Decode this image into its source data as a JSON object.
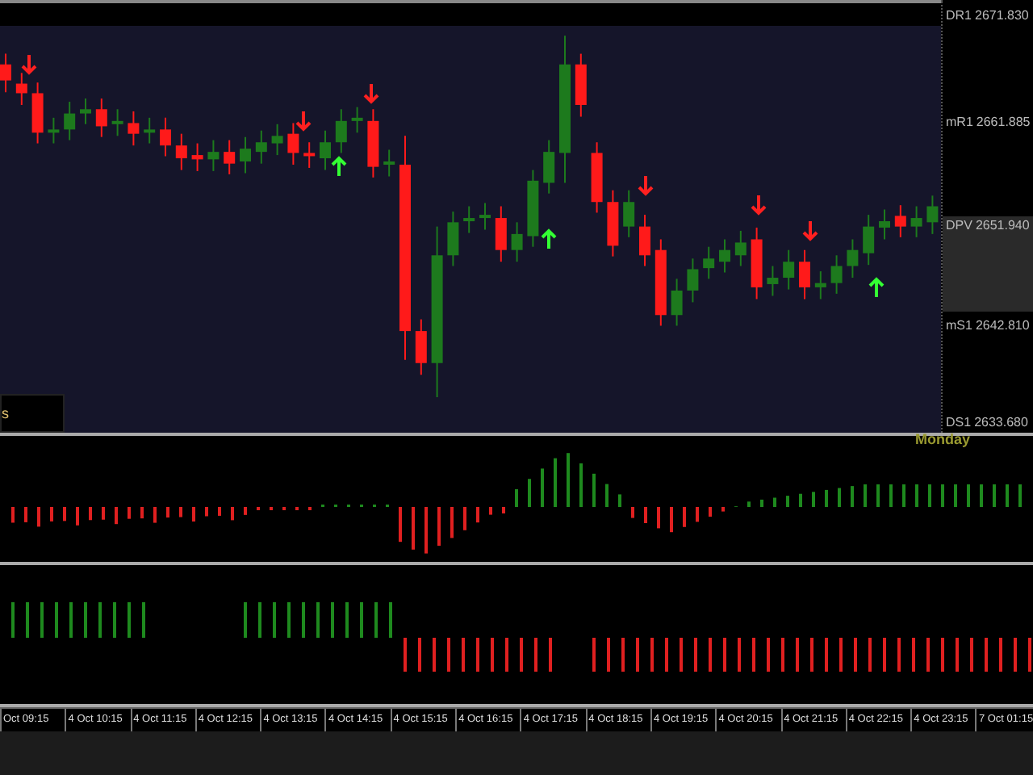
{
  "price_axis": [
    {
      "label": "DR1",
      "kind": "level"
    },
    {
      "label": "mR1",
      "kind": "level"
    },
    {
      "label": "DPV",
      "kind": "pivot"
    },
    {
      "label": "mS1",
      "kind": "level"
    },
    {
      "label": "DS1",
      "kind": "level"
    }
  ],
  "chart_data": {
    "type": "candlestick",
    "ylim": [
      2632.77,
      2673.34
    ],
    "yticks": [
      {
        "value": 2671.83,
        "label": "2671.830"
      },
      {
        "value": 2661.885,
        "label": "2661.885"
      },
      {
        "value": 2651.94,
        "label": "2651.940"
      },
      {
        "value": 2642.81,
        "label": "2642.810"
      },
      {
        "value": 2633.68,
        "label": "2633.680"
      }
    ],
    "categories": [
      null,
      null,
      null,
      null,
      null,
      null,
      null,
      null,
      null,
      null,
      null,
      null,
      null,
      null,
      null,
      null,
      null,
      null,
      null,
      null,
      null,
      null,
      null,
      null,
      null,
      null,
      null,
      null,
      null,
      null,
      null,
      null,
      null,
      null,
      null,
      null,
      null,
      null,
      null,
      null,
      null,
      null,
      null,
      null,
      null,
      null,
      null,
      null,
      null,
      null,
      null,
      null,
      null,
      null,
      null,
      null,
      null,
      null,
      null
    ],
    "ohlc": [
      [
        2667.3,
        2668.3,
        2664.7,
        2665.8
      ],
      [
        2665.5,
        2666.5,
        2663.5,
        2664.6
      ],
      [
        2664.6,
        2665.6,
        2659.9,
        2660.9
      ],
      [
        2660.9,
        2662.3,
        2659.9,
        2661.2
      ],
      [
        2661.2,
        2663.8,
        2660.2,
        2662.7
      ],
      [
        2662.7,
        2664.1,
        2661.7,
        2663.1
      ],
      [
        2663.1,
        2664.1,
        2660.5,
        2661.5
      ],
      [
        2661.7,
        2663.1,
        2660.6,
        2662.0
      ],
      [
        2661.8,
        2662.9,
        2659.7,
        2660.8
      ],
      [
        2660.9,
        2662.3,
        2659.9,
        2661.2
      ],
      [
        2661.2,
        2662.3,
        2658.7,
        2659.7
      ],
      [
        2659.7,
        2660.8,
        2657.4,
        2658.5
      ],
      [
        2658.8,
        2659.9,
        2657.3,
        2658.4
      ],
      [
        2658.4,
        2660.2,
        2657.3,
        2659.1
      ],
      [
        2659.1,
        2660.2,
        2657.0,
        2658.0
      ],
      [
        2658.2,
        2660.5,
        2657.1,
        2659.4
      ],
      [
        2659.1,
        2661.1,
        2658.0,
        2660.0
      ],
      [
        2659.9,
        2661.7,
        2658.8,
        2660.6
      ],
      [
        2660.8,
        2661.8,
        2657.9,
        2659.0
      ],
      [
        2659.0,
        2660.0,
        2657.6,
        2658.7
      ],
      [
        2658.5,
        2661.1,
        2657.4,
        2660.0
      ],
      [
        2660.0,
        2663.1,
        2659.0,
        2662.0
      ],
      [
        2662.0,
        2663.3,
        2660.9,
        2662.3
      ],
      [
        2662.0,
        2663.1,
        2656.7,
        2657.7
      ],
      [
        2657.9,
        2659.3,
        2656.8,
        2658.2
      ],
      [
        2657.9,
        2660.6,
        2639.6,
        2642.3
      ],
      [
        2642.3,
        2643.4,
        2638.2,
        2639.3
      ],
      [
        2639.3,
        2652.1,
        2636.1,
        2649.4
      ],
      [
        2649.4,
        2653.5,
        2648.4,
        2652.5
      ],
      [
        2652.6,
        2654.0,
        2651.5,
        2652.9
      ],
      [
        2652.9,
        2654.3,
        2651.8,
        2653.2
      ],
      [
        2652.9,
        2654.0,
        2648.8,
        2649.9
      ],
      [
        2649.9,
        2652.5,
        2648.8,
        2651.4
      ],
      [
        2651.2,
        2657.4,
        2650.2,
        2656.4
      ],
      [
        2656.2,
        2660.2,
        2655.2,
        2659.1
      ],
      [
        2659.0,
        2670.0,
        2656.2,
        2667.3
      ],
      [
        2667.3,
        2668.3,
        2662.4,
        2663.5
      ],
      [
        2659.0,
        2660.0,
        2653.4,
        2654.4
      ],
      [
        2654.4,
        2655.5,
        2649.3,
        2650.3
      ],
      [
        2652.1,
        2655.5,
        2651.1,
        2654.4
      ],
      [
        2652.1,
        2653.2,
        2648.4,
        2649.4
      ],
      [
        2649.9,
        2650.9,
        2642.8,
        2643.8
      ],
      [
        2643.8,
        2647.2,
        2642.8,
        2646.1
      ],
      [
        2646.1,
        2649.1,
        2645.0,
        2648.1
      ],
      [
        2648.2,
        2650.2,
        2647.2,
        2649.1
      ],
      [
        2648.8,
        2650.9,
        2647.8,
        2649.9
      ],
      [
        2649.4,
        2651.7,
        2648.4,
        2650.6
      ],
      [
        2650.9,
        2652.0,
        2645.3,
        2646.4
      ],
      [
        2646.7,
        2648.4,
        2645.6,
        2647.3
      ],
      [
        2647.3,
        2649.9,
        2646.2,
        2648.8
      ],
      [
        2648.8,
        2649.9,
        2645.3,
        2646.4
      ],
      [
        2646.4,
        2647.9,
        2645.3,
        2646.8
      ],
      [
        2646.8,
        2649.4,
        2645.8,
        2648.4
      ],
      [
        2648.4,
        2650.9,
        2647.3,
        2649.9
      ],
      [
        2649.6,
        2653.2,
        2648.5,
        2652.1
      ],
      [
        2652.0,
        2653.7,
        2650.9,
        2652.6
      ],
      [
        2653.1,
        2654.1,
        2651.1,
        2652.1
      ],
      [
        2652.1,
        2654.0,
        2651.1,
        2652.9
      ],
      [
        2652.5,
        2655.0,
        2651.4,
        2654.0
      ]
    ]
  },
  "corner_label": "s",
  "day_label": "Monday",
  "time_axis": [
    "Oct 09:15",
    "4 Oct 10:15",
    "4 Oct 11:15",
    "4 Oct 12:15",
    "4 Oct 13:15",
    "4 Oct 14:15",
    "4 Oct 15:15",
    "4 Oct 16:15",
    "4 Oct 17:15",
    "4 Oct 18:15",
    "4 Oct 19:15",
    "4 Oct 20:15",
    "4 Oct 21:15",
    "4 Oct 22:15",
    "4 Oct 23:15",
    "7 Oct 01:15"
  ]
}
